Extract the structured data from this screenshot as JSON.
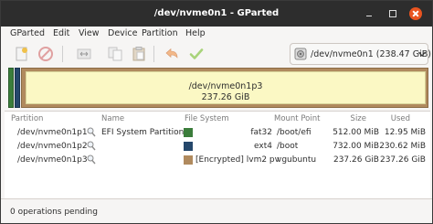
{
  "window": {
    "title": "/dev/nvme0n1 - GParted"
  },
  "menu": [
    "GParted",
    "Edit",
    "View",
    "Device",
    "Partition",
    "Help"
  ],
  "toolbar": {
    "buttons": [
      {
        "name": "new-partition",
        "icon": "new-document-icon"
      },
      {
        "name": "delete-partition",
        "icon": "no-entry-icon"
      },
      {
        "name": "resize-move",
        "icon": "resize-icon"
      },
      {
        "name": "copy",
        "icon": "copy-icon"
      },
      {
        "name": "paste",
        "icon": "paste-icon"
      },
      {
        "name": "undo",
        "icon": "undo-arrow-icon"
      },
      {
        "name": "apply",
        "icon": "checkmark-icon"
      }
    ],
    "device_selector": "/dev/nvme0n1 (238.47 GiB)"
  },
  "visual": {
    "colors": {
      "fat32": "#3b7d3b",
      "ext4": "#25476b",
      "encrypted": "#b08a5e",
      "unused": "#fbf8c4"
    },
    "large_segment": {
      "name": "/dev/nvme0n1p3",
      "size": "237.26 GiB"
    }
  },
  "table": {
    "headers": [
      "Partition",
      "Name",
      "File System",
      "Mount Point",
      "Size",
      "Used"
    ],
    "rows": [
      {
        "partition": "/dev/nvme0n1p1",
        "name": "EFI System Partition",
        "color": "#3b7d3b",
        "fs": "fat32",
        "mount": "/boot/efi",
        "size": "512.00 MiB",
        "used": "12.95 MiB"
      },
      {
        "partition": "/dev/nvme0n1p2",
        "name": "",
        "color": "#25476b",
        "fs": "ext4",
        "mount": "/boot",
        "size": "732.00 MiB",
        "used": "230.62 MiB"
      },
      {
        "partition": "/dev/nvme0n1p3",
        "name": "",
        "color": "#b08a5e",
        "fs": "[Encrypted] lvm2 pv",
        "mount": "vgubuntu",
        "size": "237.26 GiB",
        "used": "237.26 GiB"
      }
    ]
  },
  "status": "0 operations pending"
}
